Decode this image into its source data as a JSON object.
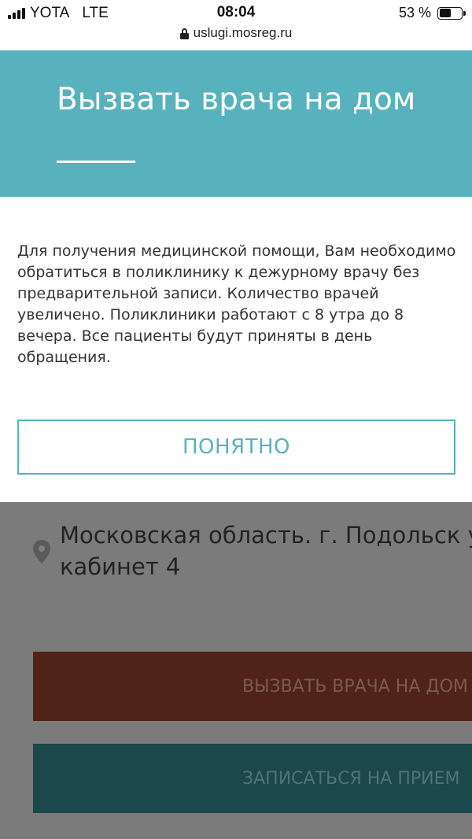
{
  "status_bar": {
    "carrier": "YOTA",
    "network": "LTE",
    "time": "08:04",
    "battery": "53 %",
    "battery_level": 0.53,
    "url": "uslugi.mosreg.ru"
  },
  "header": {
    "title": "Вызвать врача на дом"
  },
  "modal": {
    "message": "Для получения медицинской помощи, Вам необходимо обратиться в поликлинику к дежурному врачу без предварительной записи. Количество врачей увеличено. Поликлиники работают с 8 утра до 8 вечера. Все пациенты будут приняты в день обращения.",
    "ok_label": "ПОНЯТНО"
  },
  "background_page": {
    "address": "Московская область. г. Подольск у кабинет 4",
    "address_line1": "Московская область. г. Подольск у",
    "address_line2": "кабинет 4",
    "call_doctor_label": "ВЫЗВАТЬ ВРАЧА НА ДОМ",
    "appointment_label": "ЗАПИСАТЬСЯ НА ПРИЕМ"
  },
  "colors": {
    "accent": "#58b2bd",
    "call_button": "#4f2318",
    "appointment_button": "#1c474b",
    "overlay": "#7b7b7b"
  },
  "icons": {
    "lock": "lock-icon",
    "signal": "signal-icon",
    "battery": "battery-icon",
    "location": "location-pin-icon"
  }
}
